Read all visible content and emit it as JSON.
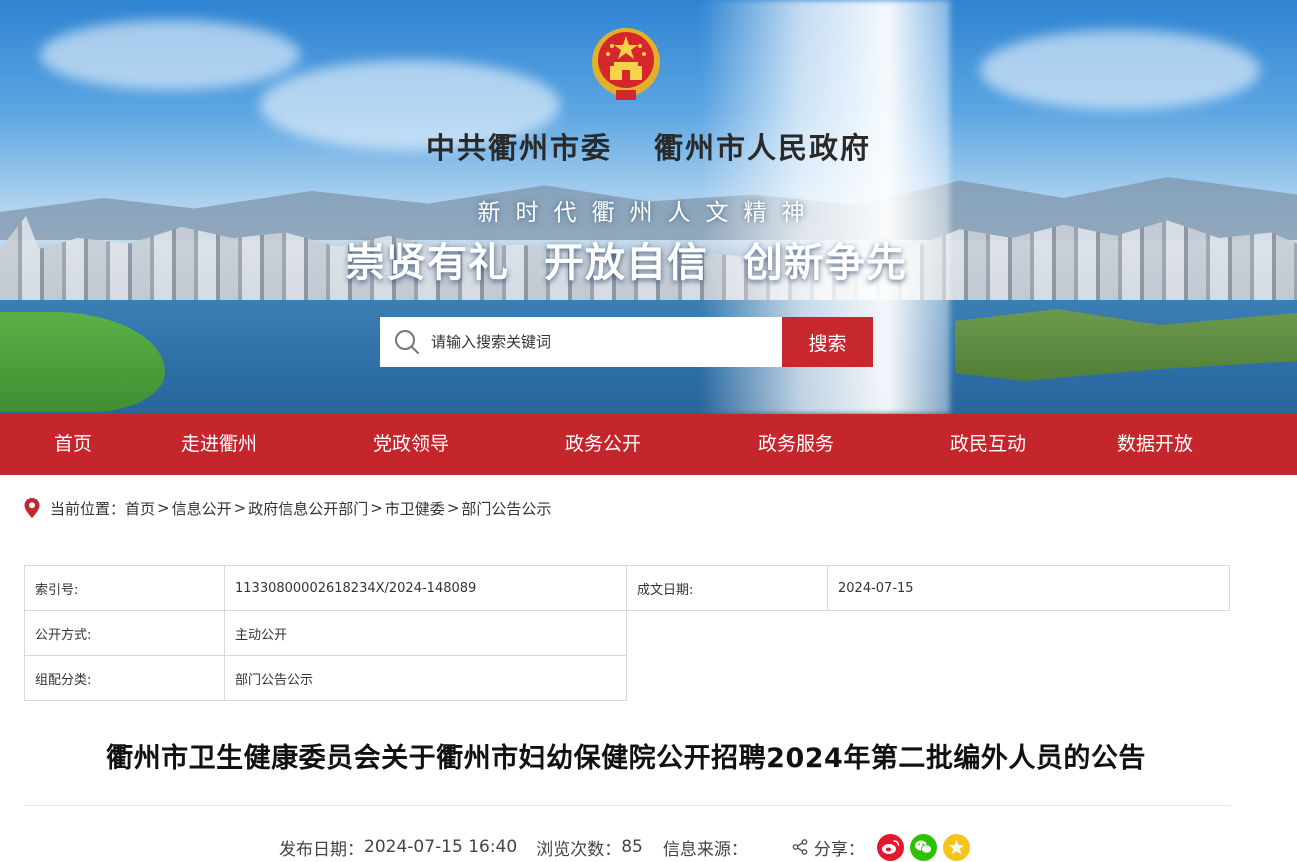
{
  "header": {
    "site_title": "中共衢州市委    衢州市人民政府",
    "slogan_sub": "新时代衢州人文精神",
    "slogan_main": "崇贤有礼  开放自信  创新争先"
  },
  "search": {
    "placeholder": "请输入搜索关键词",
    "button_label": "搜索"
  },
  "nav": {
    "items": [
      {
        "label": "首页"
      },
      {
        "label": "走进衢州"
      },
      {
        "label": "党政领导"
      },
      {
        "label": "政务公开"
      },
      {
        "label": "政务服务"
      },
      {
        "label": "政民互动"
      },
      {
        "label": "数据开放"
      }
    ]
  },
  "breadcrumb": {
    "prefix": "当前位置：",
    "items": [
      "首页",
      "信息公开",
      "政府信息公开部门",
      "市卫健委",
      "部门公告公示"
    ],
    "separator": ">"
  },
  "meta": {
    "index_label": "索引号:",
    "index_value": "11330800002618234X/2024-148089",
    "date_label": "成文日期:",
    "date_value": "2024-07-15",
    "disclosure_label": "公开方式:",
    "disclosure_value": "主动公开",
    "category_label": "组配分类:",
    "category_value": "部门公告公示"
  },
  "article": {
    "title": "衢州市卫生健康委员会关于衢州市妇幼保健院公开招聘2024年第二批编外人员的公告",
    "publish_label": "发布日期：",
    "publish_value": "2024-07-15 16:40",
    "views_label": "浏览次数：",
    "views_value": "85",
    "source_label": "信息来源：",
    "source_value": "",
    "share_label": "分享："
  },
  "colors": {
    "brand_red": "#c4262c",
    "weibo": "#e6162d",
    "wechat": "#2dc100",
    "qzone": "#f6c31a"
  },
  "icons": {
    "search": "search-icon",
    "location": "location-pin-icon",
    "share": "share-icon",
    "weibo": "weibo-icon",
    "wechat": "wechat-icon",
    "qzone": "qzone-star-icon",
    "emblem": "national-emblem-icon"
  }
}
